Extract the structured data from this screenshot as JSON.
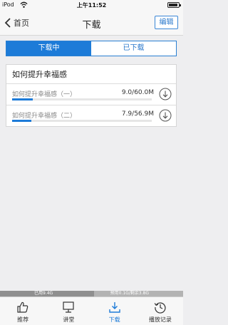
{
  "status_bar": {
    "carrier": "iPod",
    "time": "上午11:52"
  },
  "nav": {
    "back_label": "首页",
    "title": "下载",
    "edit_label": "编辑"
  },
  "segment": {
    "downloading": "下载中",
    "downloaded": "已下载"
  },
  "course": {
    "title": "如何提升幸福感",
    "items": [
      {
        "name": "如何提升幸福感（一）",
        "size": "9.0/60.0M",
        "progress": 0.15
      },
      {
        "name": "如何提升幸福感（二）",
        "size": "7.9/56.9M",
        "progress": 0.14
      }
    ]
  },
  "storage": {
    "used": "已用9.4G",
    "free": "预用0.1G/剩余3.8G"
  },
  "tabs": [
    {
      "label": "推荐",
      "icon": "thumbs-up-icon"
    },
    {
      "label": "讲堂",
      "icon": "classroom-icon"
    },
    {
      "label": "下载",
      "icon": "download-icon",
      "active": true
    },
    {
      "label": "播放记录",
      "icon": "history-icon"
    }
  ],
  "colors": {
    "accent": "#1d7bd8",
    "background": "#eeeef0"
  }
}
